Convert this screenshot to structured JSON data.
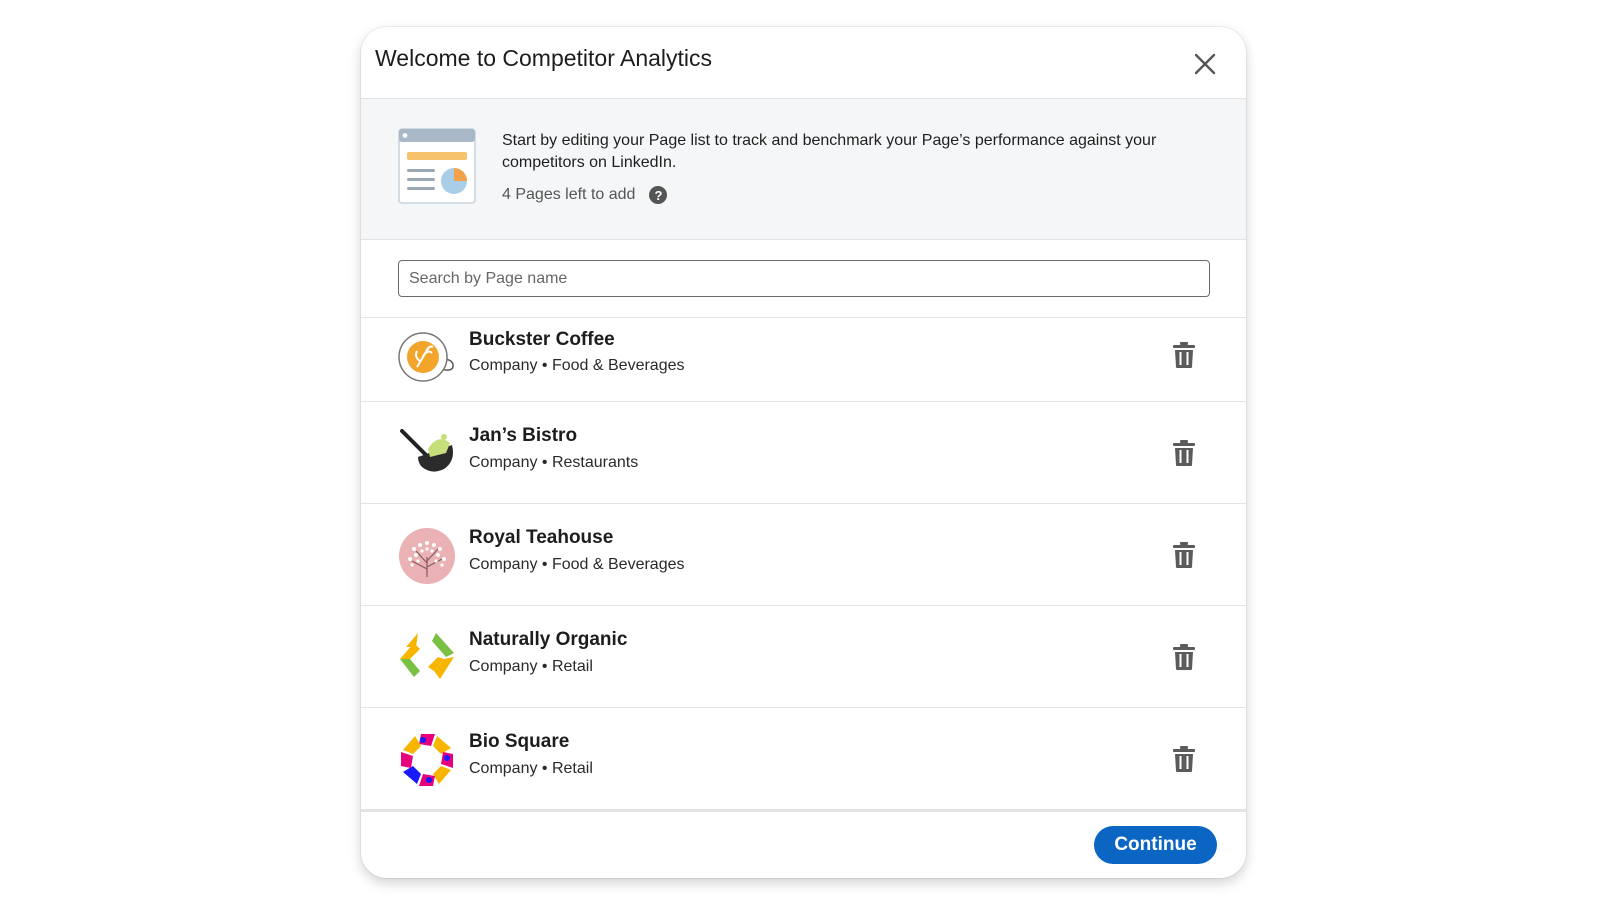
{
  "dialog": {
    "title": "Welcome to Competitor Analytics",
    "close_icon": "close-icon"
  },
  "intro": {
    "description": "Start by editing your Page list to track and benchmark your Page’s performance against your competitors on LinkedIn.",
    "pages_left": "4 Pages left to add",
    "help_icon": "help-icon",
    "help_glyph": "?"
  },
  "search": {
    "placeholder": "Search by Page name",
    "value": ""
  },
  "pages": [
    {
      "name": "Buckster Coffee",
      "meta": "Company • Food & Beverages",
      "logo": "buckster-coffee-logo"
    },
    {
      "name": "Jan’s Bistro",
      "meta": "Company • Restaurants",
      "logo": "jans-bistro-logo"
    },
    {
      "name": "Royal Teahouse",
      "meta": "Company • Food & Beverages",
      "logo": "royal-teahouse-logo"
    },
    {
      "name": "Naturally Organic",
      "meta": "Company • Retail",
      "logo": "naturally-organic-logo"
    },
    {
      "name": "Bio Square",
      "meta": "Company • Retail",
      "logo": "bio-square-logo"
    }
  ],
  "footer": {
    "continue_label": "Continue"
  },
  "colors": {
    "primary": "#0a66c2",
    "intro_bg": "#f4f6f8",
    "divider": "#e3e3e3"
  }
}
